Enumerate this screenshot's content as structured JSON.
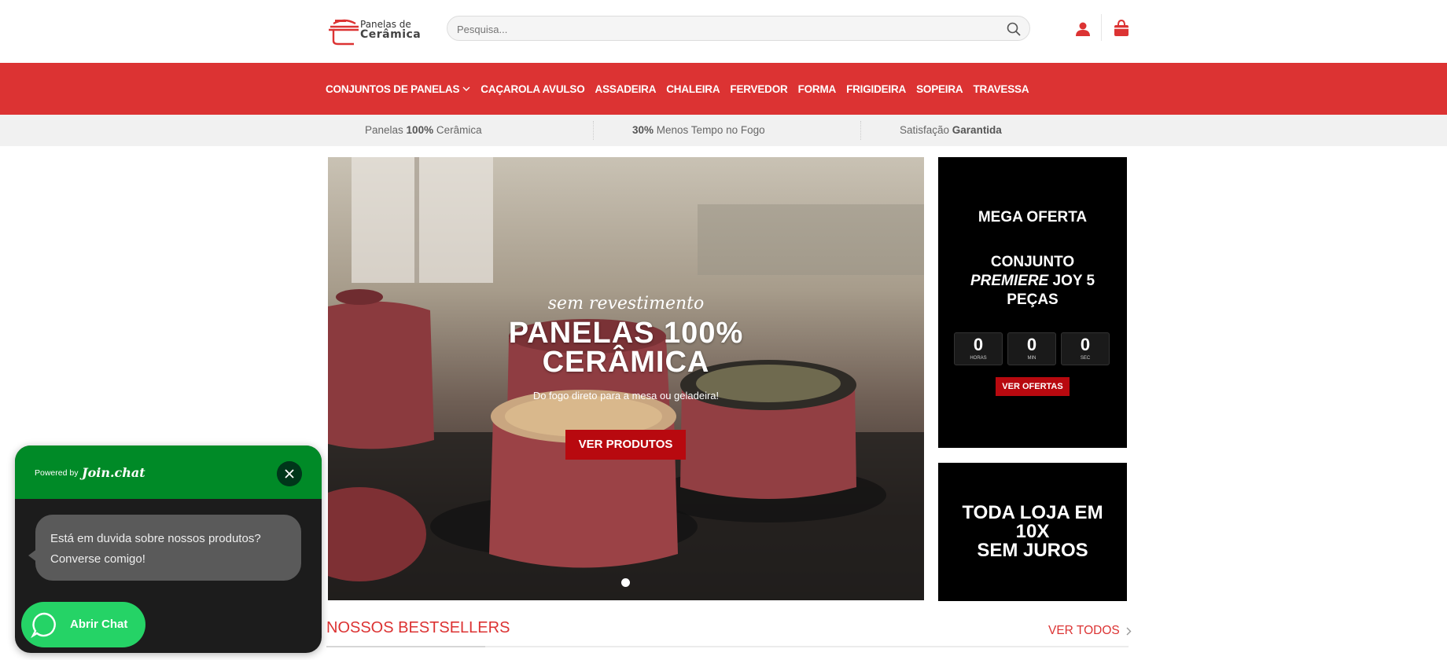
{
  "header": {
    "logo_line1": "Panelas de",
    "logo_line2": "Cerâmica",
    "search_placeholder": "Pesquisa...",
    "search_icon": "search-icon",
    "account_icon": "user-icon",
    "cart_icon": "shopping-bag-icon"
  },
  "nav": {
    "items": [
      {
        "label": "CONJUNTOS DE PANELAS",
        "has_dropdown": true
      },
      {
        "label": "CAÇAROLA AVULSO"
      },
      {
        "label": "ASSADEIRA"
      },
      {
        "label": "CHALEIRA"
      },
      {
        "label": "FERVEDOR"
      },
      {
        "label": "FORMA"
      },
      {
        "label": "FRIGIDEIRA"
      },
      {
        "label": "SOPEIRA"
      },
      {
        "label": "TRAVESSA"
      }
    ]
  },
  "usp": [
    {
      "pre": "Panelas ",
      "bold": "100%",
      "post": " Cerâmica"
    },
    {
      "pre": "",
      "bold": "30%",
      "post": " Menos Tempo no Fogo"
    },
    {
      "pre": "Satisfação ",
      "bold": "Garantida",
      "post": ""
    }
  ],
  "hero": {
    "script": "sem revestimento",
    "title_line1": "PANELAS 100%",
    "title_line2": "CERÂMICA",
    "subtitle": "Do fogo direto para a mesa ou geladeira!",
    "button": "VER PRODUTOS",
    "slide_count": 1,
    "active_slide": 1
  },
  "promo_offer": {
    "heading": "MEGA OFERTA",
    "product_line1": "CONJUNTO",
    "product_italic": "PREMIERE",
    "product_line2_rest": " JOY 5",
    "product_line3": "PEÇAS",
    "countdown": [
      {
        "value": "0",
        "label": "HORAS"
      },
      {
        "value": "0",
        "label": "MIN"
      },
      {
        "value": "0",
        "label": "SEC"
      }
    ],
    "button": "VER OFERTAS"
  },
  "promo_installments": {
    "line1": "TODA LOJA EM",
    "line2": "10X",
    "line3": "SEM JUROS"
  },
  "bestsellers": {
    "title": "NOSSOS BESTSELLERS",
    "view_all": "VER TODOS"
  },
  "chat_widget": {
    "powered_by": "Powered by",
    "brand": "Join.chat",
    "message_line1": "Está em duvida sobre nossos produtos?",
    "message_line2": "Converse comigo!",
    "button": "Abrir Chat"
  },
  "colors": {
    "brand_red": "#dc3333",
    "button_red": "#b8090f",
    "chat_green": "#008a27",
    "chat_button_green": "#25d366"
  }
}
